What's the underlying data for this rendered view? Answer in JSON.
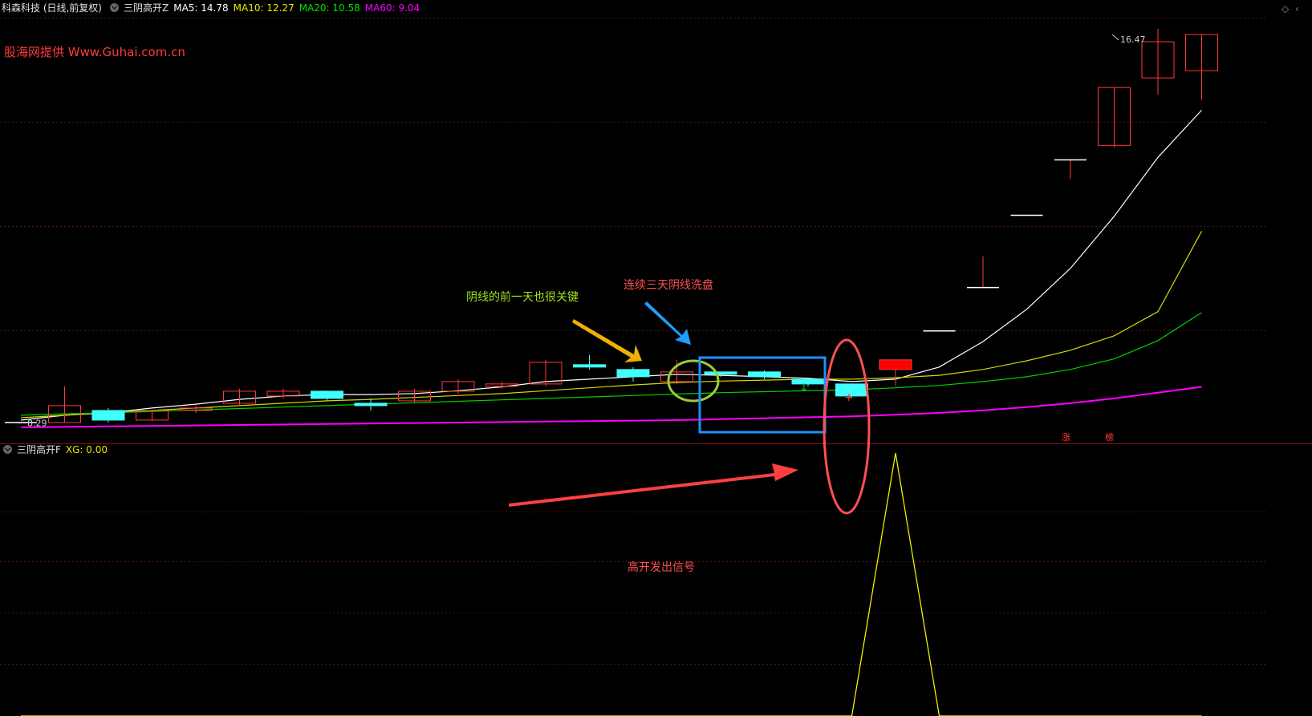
{
  "header": {
    "title": "科森科技 (日线,前复权)",
    "indicator_name": "三阴高开Z",
    "ma5": "MA5: 14.78",
    "ma10": "MA10: 12.27",
    "ma20": "MA20: 10.58",
    "ma60": "MA60: 9.04"
  },
  "sub_header": {
    "indicator_name": "三阴高开F",
    "xg": "XG: 0.00"
  },
  "watermark": "股海网提供  Www.Guhai.com.cn",
  "annotations": {
    "key_day": "阴线的前一天也很关键",
    "three_bear": "连续三天阴线洗盘",
    "signal": "高开发出信号"
  },
  "price_labels": {
    "low": "8.29",
    "high": "16.47"
  },
  "limit_labels": [
    "涨",
    "榜"
  ],
  "colors": {
    "up": "#ff3b3b",
    "down": "#40ffff",
    "ma5": "#ffffff",
    "ma10": "#d8d800",
    "ma20": "#00d000",
    "ma60": "#ff00ff",
    "xg": "#ffff00",
    "grid": "#5a1010"
  },
  "chart_data": [
    {
      "type": "candlestick",
      "title": "科森科技 (日线,前复权)",
      "series": [
        {
          "name": "K",
          "ohlc": [
            [
              8.3,
              8.3,
              8.29,
              8.29
            ],
            [
              8.3,
              8.65,
              8.3,
              9.05
            ],
            [
              8.55,
              8.35,
              8.3,
              8.6
            ],
            [
              8.35,
              8.55,
              8.33,
              8.55
            ],
            [
              8.55,
              8.6,
              8.5,
              8.65
            ],
            [
              8.7,
              8.95,
              8.65,
              9.0
            ],
            [
              8.85,
              8.95,
              8.8,
              9.0
            ],
            [
              8.95,
              8.8,
              8.75,
              8.96
            ],
            [
              8.7,
              8.65,
              8.55,
              8.8
            ],
            [
              8.75,
              8.95,
              8.72,
              9.0
            ],
            [
              8.95,
              9.15,
              8.9,
              9.2
            ],
            [
              9.05,
              9.1,
              9.0,
              9.15
            ],
            [
              9.1,
              9.55,
              9.05,
              9.6
            ],
            [
              9.5,
              9.45,
              9.4,
              9.7
            ],
            [
              9.4,
              9.25,
              9.15,
              9.45
            ],
            [
              9.15,
              9.35,
              9.1,
              9.6
            ],
            [
              9.35,
              9.3,
              9.25,
              9.35
            ],
            [
              9.35,
              9.25,
              9.2,
              9.38
            ],
            [
              9.2,
              9.1,
              9.05,
              9.23
            ],
            [
              9.1,
              8.85,
              8.8,
              9.1
            ],
            [
              9.4,
              9.6,
              9.05,
              9.6
            ],
            [
              10.2,
              10.2,
              10.2,
              10.2
            ],
            [
              11.1,
              11.1,
              11.1,
              11.75
            ],
            [
              12.6,
              12.6,
              12.6,
              12.6
            ],
            [
              13.75,
              13.75,
              13.35,
              13.75
            ],
            [
              14.05,
              15.25,
              14.0,
              15.25
            ],
            [
              15.45,
              16.2,
              15.1,
              16.47
            ],
            [
              15.6,
              16.35,
              15.0,
              16.35
            ]
          ]
        },
        {
          "name": "MA5",
          "values": [
            8.35,
            8.45,
            8.5,
            8.6,
            8.68,
            8.78,
            8.85,
            8.88,
            8.88,
            8.9,
            8.96,
            9.04,
            9.15,
            9.2,
            9.25,
            9.3,
            9.28,
            9.25,
            9.22,
            9.15,
            9.2,
            9.45,
            9.98,
            10.65,
            11.5,
            12.58,
            13.8,
            14.78
          ]
        },
        {
          "name": "MA10",
          "values": [
            8.4,
            8.45,
            8.5,
            8.55,
            8.6,
            8.65,
            8.7,
            8.75,
            8.78,
            8.82,
            8.86,
            8.9,
            8.96,
            9.02,
            9.08,
            9.13,
            9.16,
            9.18,
            9.2,
            9.2,
            9.23,
            9.28,
            9.4,
            9.58,
            9.8,
            10.1,
            10.6,
            12.27
          ]
        },
        {
          "name": "MA20",
          "values": [
            8.45,
            8.48,
            8.5,
            8.53,
            8.56,
            8.59,
            8.62,
            8.65,
            8.68,
            8.71,
            8.74,
            8.77,
            8.8,
            8.83,
            8.86,
            8.89,
            8.92,
            8.94,
            8.96,
            8.98,
            9.02,
            9.07,
            9.15,
            9.25,
            9.4,
            9.62,
            10.0,
            10.58
          ]
        },
        {
          "name": "MA60",
          "values": [
            8.2,
            8.21,
            8.22,
            8.23,
            8.24,
            8.25,
            8.26,
            8.27,
            8.28,
            8.29,
            8.3,
            8.31,
            8.32,
            8.33,
            8.34,
            8.35,
            8.37,
            8.39,
            8.41,
            8.43,
            8.46,
            8.5,
            8.55,
            8.62,
            8.7,
            8.8,
            8.92,
            9.04
          ]
        }
      ],
      "ylim": [
        8.0,
        16.7
      ],
      "grid": true
    },
    {
      "type": "line",
      "title": "三阴高开F",
      "series": [
        {
          "name": "XG",
          "values": [
            0,
            0,
            0,
            0,
            0,
            0,
            0,
            0,
            0,
            0,
            0,
            0,
            0,
            0,
            0,
            0,
            0,
            0,
            0,
            0,
            1,
            0,
            0,
            0,
            0,
            0,
            0,
            0
          ]
        }
      ],
      "ylim": [
        0,
        1
      ],
      "grid": true
    }
  ]
}
